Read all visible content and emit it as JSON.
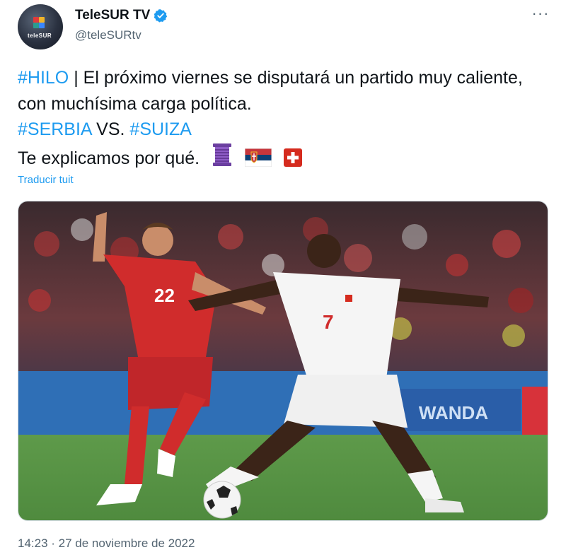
{
  "header": {
    "display_name": "TeleSUR TV",
    "handle": "@teleSURtv",
    "avatar_text": "teleSUR",
    "verified_icon": "verified-badge-icon",
    "more_icon": "more-options-icon",
    "more_glyph": "···"
  },
  "tweet": {
    "line1_tag": "#HILO",
    "line1_text": " | El próximo viernes se disputará un partido muy caliente, con muchísima carga política.",
    "line2_tag1": "#SERBIA",
    "line2_mid": " VS. ",
    "line2_tag2": "#SUIZA",
    "line3_text": "Te explicamos por qué.",
    "emojis": [
      "thread-spool-icon",
      "serbia-flag-icon",
      "switzerland-flag-icon"
    ]
  },
  "translate_label": "Traducir tuit",
  "media": {
    "description_icon": "football-match-photo",
    "player_left_number": "22",
    "player_right_number": "7",
    "banner_text": "WANDA"
  },
  "timestamp": "14:23 · 27 de noviembre de 2022",
  "colors": {
    "link": "#1d9bf0",
    "text": "#0f1419",
    "secondary": "#536471"
  }
}
